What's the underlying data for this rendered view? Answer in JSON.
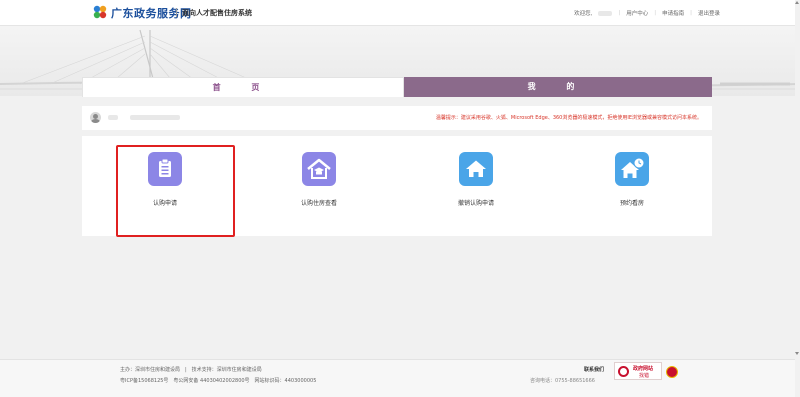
{
  "header": {
    "site_name": "广东政务服务网",
    "system_name": "面向人才配售住房系统",
    "greeting": "欢迎您,",
    "user_center": "用户中心",
    "apply_guide": "申请指南",
    "logout": "退出登录"
  },
  "nav": {
    "home_label": "首 页",
    "mine_label": "我 的"
  },
  "info": {
    "tip": "温馨提示：建议采用谷歌、火狐、Microsoft Edge、360浏览器的极速模式，拒绝使用IE浏览器或兼容模式访问本系统。"
  },
  "cards": [
    {
      "label": "认购申请",
      "color": "#8c86e6",
      "icon": "clipboard-icon"
    },
    {
      "label": "认购住房查看",
      "color": "#8c86e6",
      "icon": "house-graduation-icon"
    },
    {
      "label": "撤销认购申请",
      "color": "#4aa5e8",
      "icon": "home-icon"
    },
    {
      "label": "预约看房",
      "color": "#4aa5e8",
      "icon": "house-clock-icon"
    }
  ],
  "footer": {
    "line1": "主办：深圳市住房和建设局　|　技术支持：深圳市住房和建设局",
    "line2": "粤ICP备15068125号　粤公网安备 44030402002800号　网站标识码：4403000005",
    "contact_title": "联系我们",
    "contact_phone": "咨询电话：0755-88651666",
    "gov_title": "政府网站",
    "gov_sub": "找错"
  }
}
